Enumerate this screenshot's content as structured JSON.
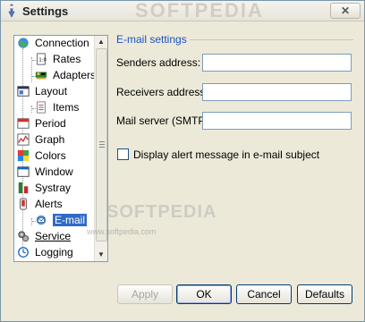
{
  "window": {
    "title": "Settings",
    "close_label": "✕",
    "watermark": "SOFTPEDIA"
  },
  "tree": {
    "items": [
      {
        "label": "Connection",
        "icon": "globe-icon"
      },
      {
        "label": "Rates",
        "icon": "document-icon"
      },
      {
        "label": "Adapters",
        "icon": "network-card-icon"
      },
      {
        "label": "Layout",
        "icon": "layout-icon"
      },
      {
        "label": "Items",
        "icon": "list-icon"
      },
      {
        "label": "Period",
        "icon": "calendar-icon"
      },
      {
        "label": "Graph",
        "icon": "graph-icon"
      },
      {
        "label": "Colors",
        "icon": "palette-icon"
      },
      {
        "label": "Window",
        "icon": "window-icon"
      },
      {
        "label": "Systray",
        "icon": "systray-icon"
      },
      {
        "label": "Alerts",
        "icon": "alert-icon"
      },
      {
        "label": "E-mail",
        "icon": "email-icon"
      },
      {
        "label": "Service",
        "icon": "service-icon"
      },
      {
        "label": "Logging",
        "icon": "logging-icon"
      }
    ],
    "selected": "E-mail"
  },
  "email_settings": {
    "group_title": "E-mail settings",
    "senders_label": "Senders address:",
    "senders_value": "",
    "receivers_label": "Receivers address:",
    "receivers_value": "",
    "server_label": "Mail server (SMTP):",
    "server_value": "",
    "alert_checkbox_label": "Display alert message in e-mail subject",
    "alert_checked": false
  },
  "buttons": {
    "apply": "Apply",
    "ok": "OK",
    "cancel": "Cancel",
    "defaults": "Defaults"
  },
  "overlay": {
    "softpedia_large": "SOFTPEDIA",
    "softpedia_small": "www.softpedia.com"
  }
}
